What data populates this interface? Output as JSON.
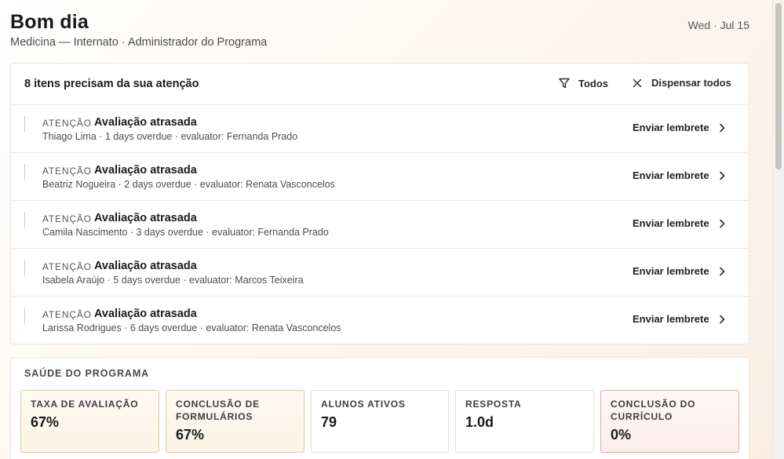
{
  "header": {
    "greeting": "Bom dia",
    "subtitle": "Medicina — Internato · Administrador do Programa",
    "date": "Wed · Jul 15"
  },
  "attention": {
    "title": "8 itens precisam da sua atenção",
    "filter_label": "Todos",
    "dismiss_label": "Dispensar todos",
    "items": [
      {
        "tag": "ATENÇÃO",
        "title": "Avaliação atrasada",
        "meta": "Thiago Lima · 1 days overdue · evaluator: Fernanda Prado",
        "action": "Enviar lembrete"
      },
      {
        "tag": "ATENÇÃO",
        "title": "Avaliação atrasada",
        "meta": "Beatriz Nogueira · 2 days overdue · evaluator: Renata Vasconcelos",
        "action": "Enviar lembrete"
      },
      {
        "tag": "ATENÇÃO",
        "title": "Avaliação atrasada",
        "meta": "Camila Nascimento · 3 days overdue · evaluator: Fernanda Prado",
        "action": "Enviar lembrete"
      },
      {
        "tag": "ATENÇÃO",
        "title": "Avaliação atrasada",
        "meta": "Isabela Araújo · 5 days overdue · evaluator: Marcos Teixeira",
        "action": "Enviar lembrete"
      },
      {
        "tag": "ATENÇÃO",
        "title": "Avaliação atrasada",
        "meta": "Larissa Rodrigues · 6 days overdue · evaluator: Renata Vasconcelos",
        "action": "Enviar lembrete"
      }
    ]
  },
  "health": {
    "title": "SAÚDE DO PROGRAMA",
    "metrics": [
      {
        "label": "TAXA DE AVALIAÇÃO",
        "value": "67%",
        "status": "warn"
      },
      {
        "label": "CONCLUSÃO DE FORMULÁRIOS",
        "value": "67%",
        "status": "warn"
      },
      {
        "label": "ALUNOS ATIVOS",
        "value": "79",
        "status": "neutral"
      },
      {
        "label": "RESPOSTA",
        "value": "1.0d",
        "status": "neutral"
      },
      {
        "label": "CONCLUSÃO DO CURRÍCULO",
        "value": "0%",
        "status": "bad"
      }
    ]
  },
  "colors": {
    "warn_border": "#e8c49a",
    "bad_border": "#e4a8ad",
    "text_primary": "#1a1a1a"
  },
  "icons": {
    "filter": "filter-icon",
    "dismiss": "close-icon",
    "row_action": "chevron-right-icon"
  }
}
